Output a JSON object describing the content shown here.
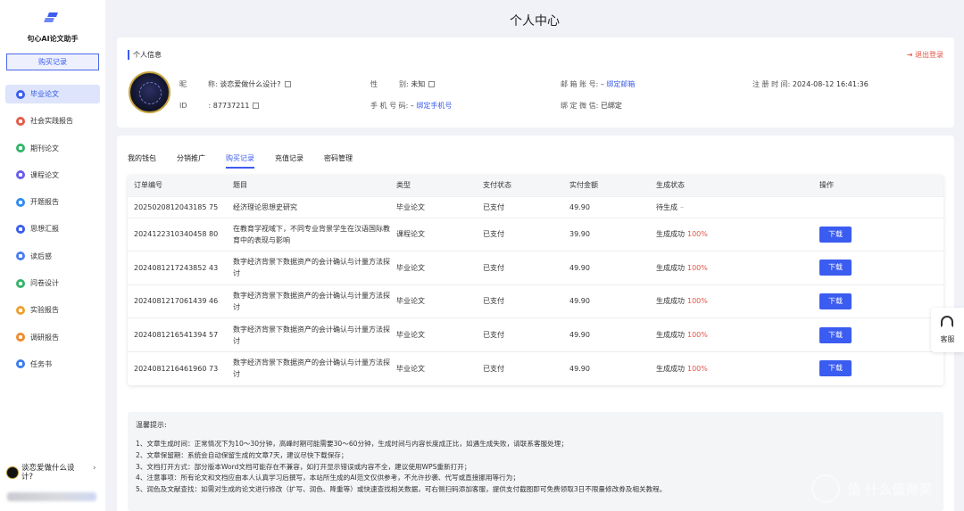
{
  "sidebar": {
    "app_title": "句心AI论文助手",
    "buy_button": "购买记录",
    "items": [
      {
        "label": "毕业论文",
        "color": "#3b5cf0",
        "icon": "graduation-icon",
        "active": true
      },
      {
        "label": "社会实践报告",
        "color": "#e8594a",
        "icon": "practice-report-icon"
      },
      {
        "label": "期刊论文",
        "color": "#35b36b",
        "icon": "journal-icon"
      },
      {
        "label": "课程论文",
        "color": "#6a5cf0",
        "icon": "course-icon"
      },
      {
        "label": "开题报告",
        "color": "#2f8bf0",
        "icon": "proposal-icon"
      },
      {
        "label": "思想汇报",
        "color": "#3b5cf0",
        "icon": "thought-report-icon"
      },
      {
        "label": "读后感",
        "color": "#4a7ff0",
        "icon": "book-review-icon"
      },
      {
        "label": "问卷设计",
        "color": "#35b36b",
        "icon": "questionnaire-icon"
      },
      {
        "label": "实验报告",
        "color": "#f0a030",
        "icon": "experiment-icon"
      },
      {
        "label": "调研报告",
        "color": "#f08a2a",
        "icon": "survey-icon"
      },
      {
        "label": "任务书",
        "color": "#3b7cf0",
        "icon": "task-book-icon"
      }
    ],
    "user": {
      "name": "谈恋爱做什么设计?",
      "chevron": "›"
    }
  },
  "header": {
    "title": "个人中心"
  },
  "profile": {
    "section_title": "个人信息",
    "logout": "退出登录",
    "nickname_label": "昵　　　称:",
    "nickname": "谈恋爱做什么设计?",
    "id_label": "ID　　　:",
    "id": "87737211",
    "gender_label": "性　　　别:",
    "gender": "未知",
    "phone_label": "手 机 号 码:",
    "phone": "–",
    "bind_phone": "绑定手机号",
    "email_label": "邮 箱 账 号:",
    "email": "–",
    "bind_email": "绑定邮箱",
    "wechat_label": "绑 定 微 信:",
    "wechat": "已绑定",
    "register_label": "注 册 时 间:",
    "register_time": "2024-08-12 16:41:36"
  },
  "tabs": [
    {
      "label": "我的钱包",
      "active": false
    },
    {
      "label": "分销推广",
      "active": false
    },
    {
      "label": "购买记录",
      "active": true
    },
    {
      "label": "充值记录",
      "active": false
    },
    {
      "label": "密码管理",
      "active": false
    }
  ],
  "table": {
    "headers": [
      "订单编号",
      "题目",
      "类型",
      "支付状态",
      "实付金额",
      "生成状态",
      "操作"
    ],
    "rows": [
      {
        "order": "2025020812043185 75",
        "title": "经济理论思想史研究",
        "type": "毕业论文",
        "pay": "已支付",
        "amount": "49.90",
        "status": "待生成",
        "pct": "–",
        "action": ""
      },
      {
        "order": "2024122310340458 80",
        "title": "在教育学视域下，不同专业背景学生在汉语国际教育中的表现与影响",
        "type": "课程论文",
        "pay": "已支付",
        "amount": "39.90",
        "status": "生成成功",
        "pct": "100%",
        "action": "下载"
      },
      {
        "order": "2024081217243852 43",
        "title": "数字经济背景下数据资产的会计确认与计量方法探讨",
        "type": "毕业论文",
        "pay": "已支付",
        "amount": "49.90",
        "status": "生成成功",
        "pct": "100%",
        "action": "下载"
      },
      {
        "order": "2024081217061439 46",
        "title": "数字经济背景下数据资产的会计确认与计量方法探讨",
        "type": "毕业论文",
        "pay": "已支付",
        "amount": "49.90",
        "status": "生成成功",
        "pct": "100%",
        "action": "下载"
      },
      {
        "order": "2024081216541394 57",
        "title": "数字经济背景下数据资产的会计确认与计量方法探讨",
        "type": "毕业论文",
        "pay": "已支付",
        "amount": "49.90",
        "status": "生成成功",
        "pct": "100%",
        "action": "下载"
      },
      {
        "order": "2024081216461960 73",
        "title": "数字经济背景下数据资产的会计确认与计量方法探讨",
        "type": "毕业论文",
        "pay": "已支付",
        "amount": "49.90",
        "status": "生成成功",
        "pct": "100%",
        "action": "下载"
      }
    ]
  },
  "tips": {
    "title": "温馨提示:",
    "lines": [
      "1、文章生成时间：正常情况下为10～30分钟，高峰时期可能需要30～60分钟，生成时间与内容长度成正比，如遇生成失败，请联系客服处理；",
      "2、文章保留期：系统会自动保留生成的文章7天，建议尽快下载保存；",
      "3、文档打开方式：部分版本Word文档可能存在不兼容，如打开显示错误或内容不全，建议使用WPS重新打开；",
      "4、注意事项：所有论文和文档应由本人认真学习后撰写，本站所生成的AI范文仅供参考，不允许抄袭、代写或直接挪用等行为；",
      "5、润色及文献查找：如需对生成的论文进行修改（扩写、润色、降重等）或快速查找相关数据，可右侧扫码添加客服，提供支付截图即可免费领取3日不限量修改券及相关教程。"
    ]
  },
  "service": {
    "label": "客服"
  },
  "watermark": {
    "text": "值 什么值得买"
  }
}
